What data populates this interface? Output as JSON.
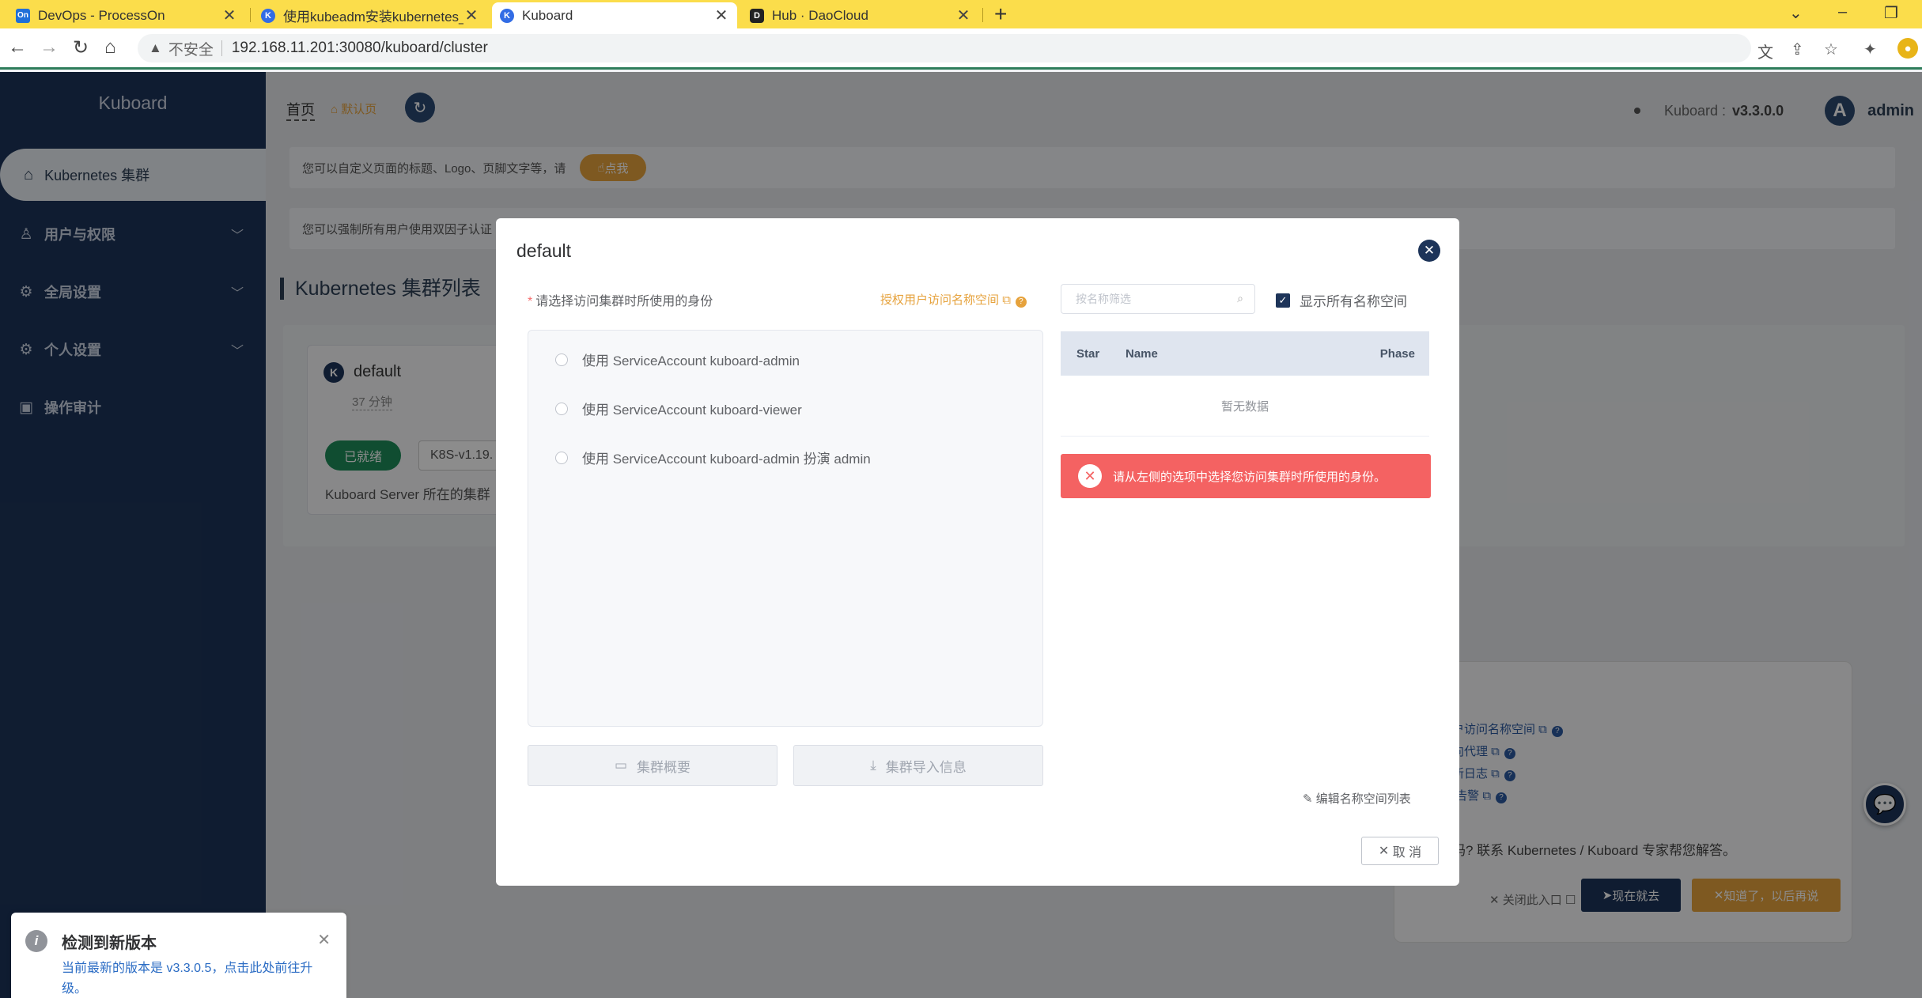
{
  "browser": {
    "tabs": [
      {
        "favicon": "On",
        "title": "DevOps - ProcessOn"
      },
      {
        "favicon": "K",
        "title": "使用kubeadm安装kubernetes_"
      },
      {
        "favicon": "K",
        "title": "Kuboard"
      },
      {
        "favicon": "D",
        "title": "Hub · DaoCloud"
      }
    ],
    "close_glyph": "✕",
    "new_tab": "+",
    "insecure_label": "不安全",
    "url": "192.168.11.201:30080/kuboard/cluster"
  },
  "sidebar": {
    "brand": "Kuboard",
    "active_item": "Kubernetes 集群",
    "items": [
      {
        "label": "用户与权限"
      },
      {
        "label": "全局设置"
      },
      {
        "label": "个人设置"
      },
      {
        "label": "操作审计"
      }
    ]
  },
  "header": {
    "breadcrumb_home": "首页",
    "breadcrumb_default": "默认页",
    "version_label": "Kuboard :",
    "version": "v3.3.0.0",
    "avatar_letter": "A",
    "username": "admin"
  },
  "tips": {
    "tip1": "您可以自定义页面的标题、Logo、页脚文字等，请",
    "tip1_button": "点我",
    "tip2": "您可以强制所有用户使用双因子认证"
  },
  "cluster_list": {
    "title": "Kubernetes 集群列表",
    "card": {
      "name": "default",
      "age": "37 分钟",
      "status": "已就绪",
      "k8s_version": "K8S-v1.19.",
      "desc": "Kuboard Server 所在的集群"
    }
  },
  "help": {
    "links": [
      "用户访问名称空间",
      "双向代理",
      "更新日志",
      "与 告警"
    ],
    "question": "了吗? 联系 Kubernetes / Kuboard 专家帮您解答。",
    "close_label": "关闭此入口",
    "go_label": "现在就去",
    "later_label": "知道了，以后再说"
  },
  "update_notice": {
    "title": "检测到新版本",
    "body": "当前最新的版本是 v3.3.0.5，点击此处前往升级。"
  },
  "modal": {
    "title": "default",
    "field_label": "请选择访问集群时所使用的身份",
    "grant_link": "授权用户访问名称空间",
    "identities": [
      "使用 ServiceAccount kuboard-admin",
      "使用 ServiceAccount kuboard-viewer",
      "使用 ServiceAccount kuboard-admin 扮演 admin"
    ],
    "btn_overview": "集群概要",
    "btn_import": "集群导入信息",
    "ns_filter_placeholder": "按名称筛选",
    "show_all_label": "显示所有名称空间",
    "table_headers": {
      "star": "Star",
      "name": "Name",
      "phase": "Phase"
    },
    "empty_text": "暂无数据",
    "error_text": "请从左侧的选项中选择您访问集群时所使用的身份。",
    "edit_ns": "编辑名称空间列表",
    "cancel": "取 消"
  }
}
